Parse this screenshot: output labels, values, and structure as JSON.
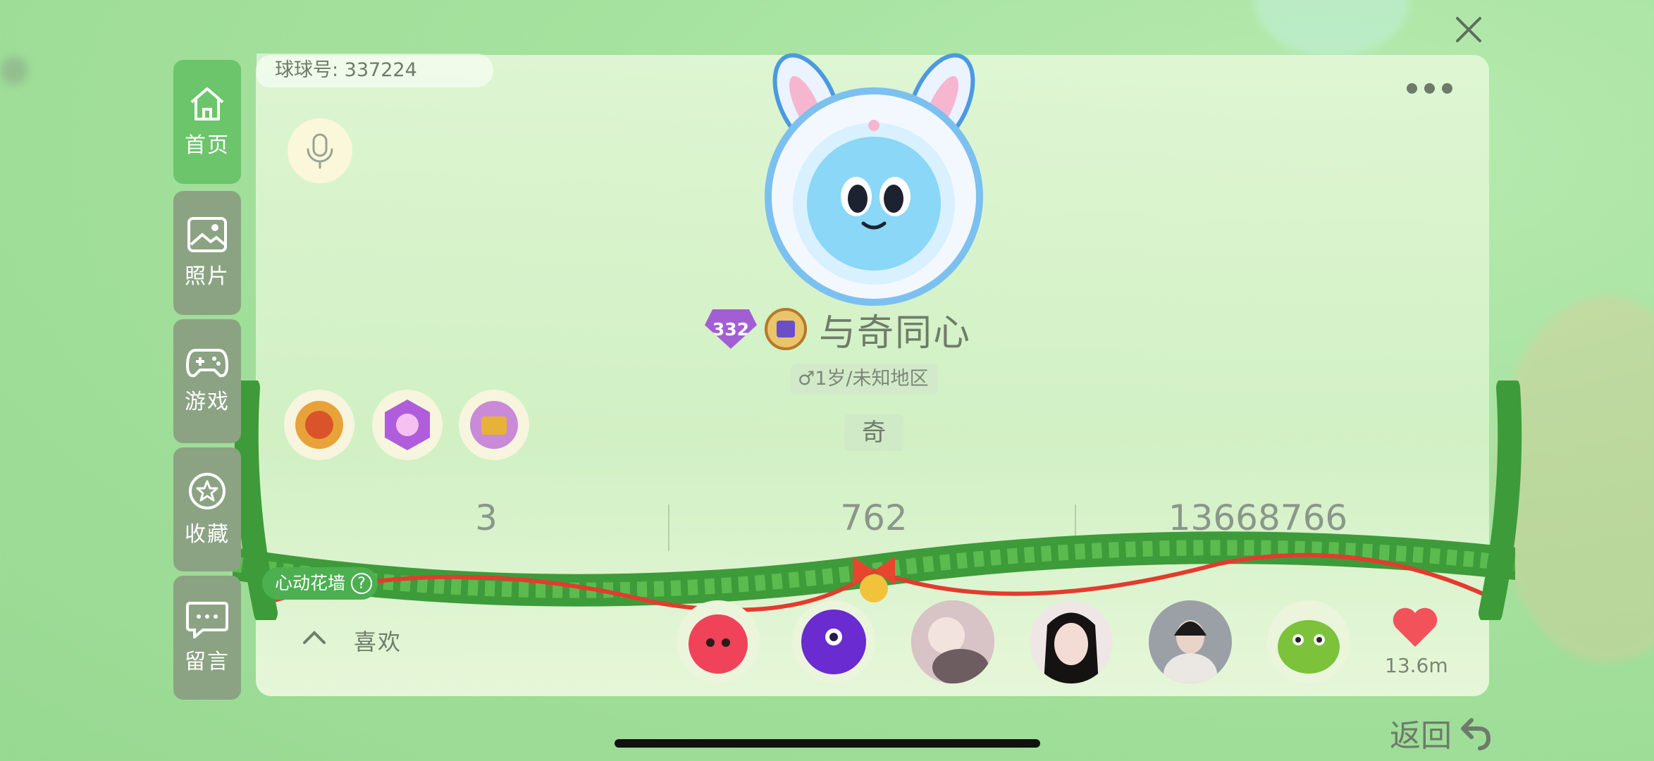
{
  "profile": {
    "id_text": "球球号: 337224",
    "nickname": "与奇同心",
    "level": "332",
    "meta": "♂1岁/未知地区",
    "tag": "奇"
  },
  "sidebar": {
    "items": [
      {
        "label": "首页",
        "icon": "home-icon",
        "active": true
      },
      {
        "label": "照片",
        "icon": "photo-icon",
        "active": false
      },
      {
        "label": "游戏",
        "icon": "gamepad-icon",
        "active": false
      },
      {
        "label": "收藏",
        "icon": "star-icon",
        "active": false
      },
      {
        "label": "留言",
        "icon": "message-icon",
        "active": false
      }
    ]
  },
  "stats": [
    "3",
    "762",
    "13668766"
  ],
  "flower_wall": {
    "label": "心动花墙",
    "help": "?"
  },
  "likes": {
    "label": "喜欢",
    "count": "13.6m"
  },
  "actions": {
    "back_label": "返回"
  },
  "colors": {
    "active_tab": "#6cc56b",
    "inactive_tab": "#8ba383",
    "flower_wall": "#4caf50",
    "heart": "#f2535a"
  }
}
